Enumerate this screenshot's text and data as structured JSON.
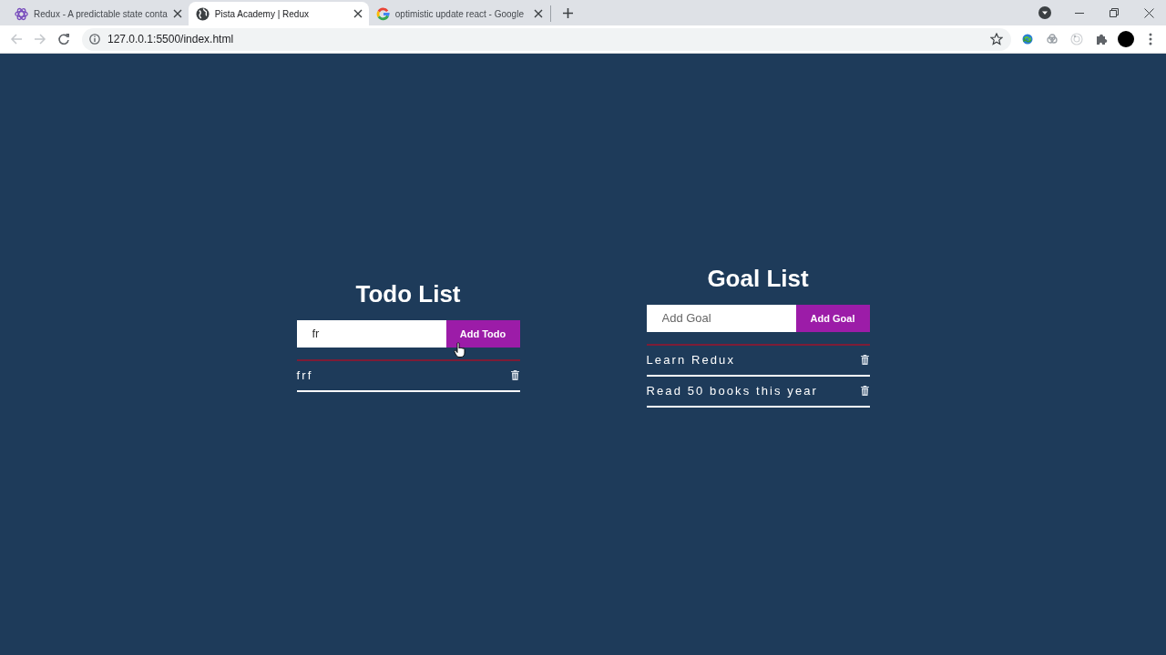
{
  "browser": {
    "tabs": [
      {
        "title": "Redux - A predictable state conta",
        "selected": false
      },
      {
        "title": "Pista Academy | Redux",
        "selected": true
      },
      {
        "title": "optimistic update react - Google",
        "selected": false
      }
    ],
    "address": "127.0.0.1:5500/index.html"
  },
  "sections": [
    {
      "title": "Todo List",
      "input": {
        "value": "fr"
      },
      "button": "Add Todo",
      "items": [
        {
          "text": "frf"
        }
      ]
    },
    {
      "title": "Goal List",
      "input": {
        "placeholder": "Add Goal"
      },
      "button": "Add Goal",
      "items": [
        {
          "text": "Learn Redux"
        },
        {
          "text": "Read 50 books this year"
        }
      ]
    }
  ]
}
